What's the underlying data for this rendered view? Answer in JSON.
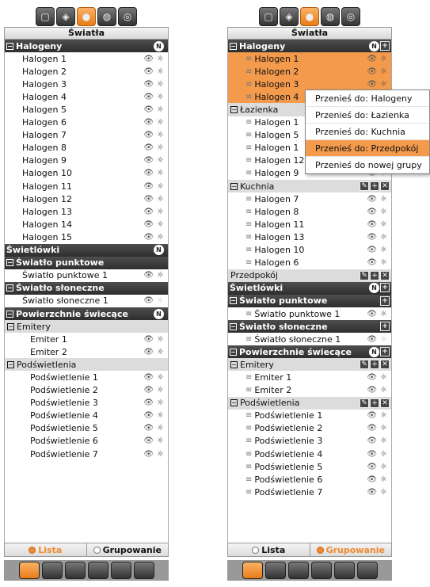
{
  "left": {
    "title": "Światła",
    "rows": [
      {
        "t": "h1",
        "label": "Halogeny",
        "badge": "N"
      },
      {
        "t": "item",
        "label": "Halogen 1"
      },
      {
        "t": "item",
        "label": "Halogen 2"
      },
      {
        "t": "item",
        "label": "Halogen 3"
      },
      {
        "t": "item",
        "label": "Halogen 4"
      },
      {
        "t": "item",
        "label": "Halogen 5"
      },
      {
        "t": "item",
        "label": "Halogen 6"
      },
      {
        "t": "item",
        "label": "Halogen 7"
      },
      {
        "t": "item",
        "label": "Halogen 8"
      },
      {
        "t": "item",
        "label": "Halogen 9"
      },
      {
        "t": "item",
        "label": "Halogen 10"
      },
      {
        "t": "item",
        "label": "Halogen 11"
      },
      {
        "t": "item",
        "label": "Halogen 12"
      },
      {
        "t": "item",
        "label": "Halogen 13"
      },
      {
        "t": "item",
        "label": "Halogen 14"
      },
      {
        "t": "item",
        "label": "Halogen 15"
      },
      {
        "t": "h1c",
        "label": "Świetlówki",
        "badge": "N"
      },
      {
        "t": "h1",
        "label": "Światło punktowe"
      },
      {
        "t": "item",
        "label": "Światło punktowe 1"
      },
      {
        "t": "h1",
        "label": "Światło słoneczne"
      },
      {
        "t": "item",
        "label": "Światło słoneczne 1",
        "dim": true
      },
      {
        "t": "h1",
        "label": "Powierzchnie świecące",
        "badge": "N"
      },
      {
        "t": "h2",
        "label": "Emitery"
      },
      {
        "t": "item2",
        "label": "Emiter 1"
      },
      {
        "t": "item2",
        "label": "Emiter 2"
      },
      {
        "t": "h2",
        "label": "Podświetlenia"
      },
      {
        "t": "item2",
        "label": "Podświetlenie 1"
      },
      {
        "t": "item2",
        "label": "Podświetlenie 2"
      },
      {
        "t": "item2",
        "label": "Podświetlenie 3"
      },
      {
        "t": "item2",
        "label": "Podświetlenie 4"
      },
      {
        "t": "item2",
        "label": "Podświetlenie 5"
      },
      {
        "t": "item2",
        "label": "Podświetlenie 6"
      },
      {
        "t": "item2",
        "label": "Podświetlenie 7"
      }
    ],
    "tab_lista": "Lista",
    "tab_grupowanie": "Grupowanie",
    "active_tab": "lista"
  },
  "right": {
    "title": "Światła",
    "rows": [
      {
        "t": "h1",
        "label": "Halogeny",
        "badge": "N",
        "plus": true
      },
      {
        "t": "item",
        "label": "Halogen 1",
        "sel": true,
        "grip": true
      },
      {
        "t": "item",
        "label": "Halogen 2",
        "sel": true,
        "grip": true
      },
      {
        "t": "item",
        "label": "Halogen 3",
        "sel": true,
        "grip": true
      },
      {
        "t": "item",
        "label": "Halogen 4",
        "sel": true,
        "grip": true
      },
      {
        "t": "h2",
        "label": "Łazienka"
      },
      {
        "t": "item",
        "label": "Halogen 1",
        "grip": true
      },
      {
        "t": "item",
        "label": "Halogen 5",
        "grip": true
      },
      {
        "t": "item",
        "label": "Halogen 1",
        "grip": true
      },
      {
        "t": "item",
        "label": "Halogen 12",
        "grip": true
      },
      {
        "t": "item",
        "label": "Halogen 9",
        "grip": true
      },
      {
        "t": "h2",
        "label": "Kuchnia",
        "ctrls": true
      },
      {
        "t": "item",
        "label": "Halogen 7",
        "grip": true
      },
      {
        "t": "item",
        "label": "Halogen 8",
        "grip": true
      },
      {
        "t": "item",
        "label": "Halogen 11",
        "grip": true
      },
      {
        "t": "item",
        "label": "Halogen 13",
        "grip": true
      },
      {
        "t": "item",
        "label": "Halogen 10",
        "grip": true
      },
      {
        "t": "item",
        "label": "Halogen 6",
        "grip": true
      },
      {
        "t": "h2n",
        "label": "Przedpokój",
        "ctrls": true
      },
      {
        "t": "h1c",
        "label": "Świetlówki",
        "badge": "N",
        "plus": true
      },
      {
        "t": "h1",
        "label": "Światło punktowe",
        "plus": true
      },
      {
        "t": "item",
        "label": "Światło punktowe 1",
        "grip": true
      },
      {
        "t": "h1",
        "label": "Światło słoneczne",
        "plus": true
      },
      {
        "t": "item",
        "label": "Światło słoneczne 1",
        "grip": true,
        "dim": true
      },
      {
        "t": "h1",
        "label": "Powierzchnie świecące",
        "badge": "N",
        "plus": true
      },
      {
        "t": "h2",
        "label": "Emitery",
        "ctrls": true
      },
      {
        "t": "item",
        "label": "Emiter 1",
        "grip": true
      },
      {
        "t": "item",
        "label": "Emiter 2",
        "grip": true
      },
      {
        "t": "h2",
        "label": "Podświetlenia",
        "ctrls": true
      },
      {
        "t": "item",
        "label": "Podświetlenie 1",
        "grip": true
      },
      {
        "t": "item",
        "label": "Podświetlenie 2",
        "grip": true
      },
      {
        "t": "item",
        "label": "Podświetlenie 3",
        "grip": true
      },
      {
        "t": "item",
        "label": "Podświetlenie 4",
        "grip": true
      },
      {
        "t": "item",
        "label": "Podświetlenie 5",
        "grip": true
      },
      {
        "t": "item",
        "label": "Podświetlenie 6",
        "grip": true
      },
      {
        "t": "item",
        "label": "Podświetlenie 7",
        "grip": true
      }
    ],
    "tab_lista": "Lista",
    "tab_grupowanie": "Grupowanie",
    "active_tab": "grupowanie"
  },
  "context_menu": {
    "items": [
      "Przenieś do: Halogeny",
      "Przenieś do: Łazienka",
      "Przenieś do: Kuchnia",
      "Przenieś do: Przedpokój",
      "Przenieś do nowej grupy"
    ],
    "highlighted": 3
  },
  "icons": {
    "eye": "👁",
    "sun": "☼",
    "plus": "+",
    "edit": "✎",
    "close": "✕",
    "expand": "−",
    "grip": "≡"
  },
  "colors": {
    "accent": "#f39a4c",
    "header": "#3a3a3a"
  }
}
